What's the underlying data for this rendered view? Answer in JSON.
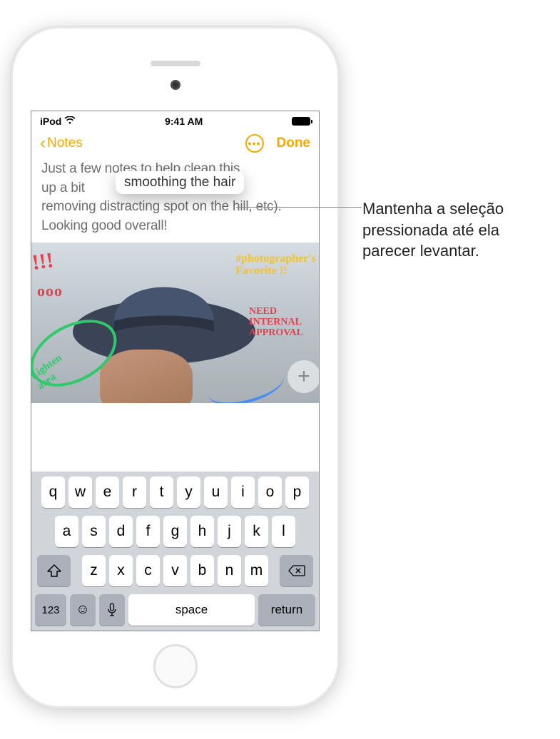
{
  "status": {
    "carrier": "iPod",
    "time": "9:41 AM"
  },
  "nav": {
    "back": "Notes",
    "done": "Done"
  },
  "note": {
    "line1": "Just a few notes to help clean this",
    "line2": "up a bit",
    "line3": "removing distracting spot on the hill, etc). Looking good overall!"
  },
  "lift_text": "smoothing the hair",
  "annotations": {
    "exclamations": "!!!",
    "circles": "ooo",
    "favorite_l1": "#photographer's",
    "favorite_l2": "Favorite !!",
    "need_l1": "NEED",
    "need_l2": "INTERNAL",
    "need_l3": "APPROVAL",
    "lighten_l1": "Lighten",
    "lighten_l2": "area"
  },
  "keyboard": {
    "row1": [
      "q",
      "w",
      "e",
      "r",
      "t",
      "y",
      "u",
      "i",
      "o",
      "p"
    ],
    "row2": [
      "a",
      "s",
      "d",
      "f",
      "g",
      "h",
      "j",
      "k",
      "l"
    ],
    "row3": [
      "z",
      "x",
      "c",
      "v",
      "b",
      "n",
      "m"
    ],
    "numbers": "123",
    "space": "space",
    "return": "return"
  },
  "callout": {
    "l1": "Mantenha a seleção",
    "l2": "pressionada até ela",
    "l3": "parecer levantar."
  }
}
